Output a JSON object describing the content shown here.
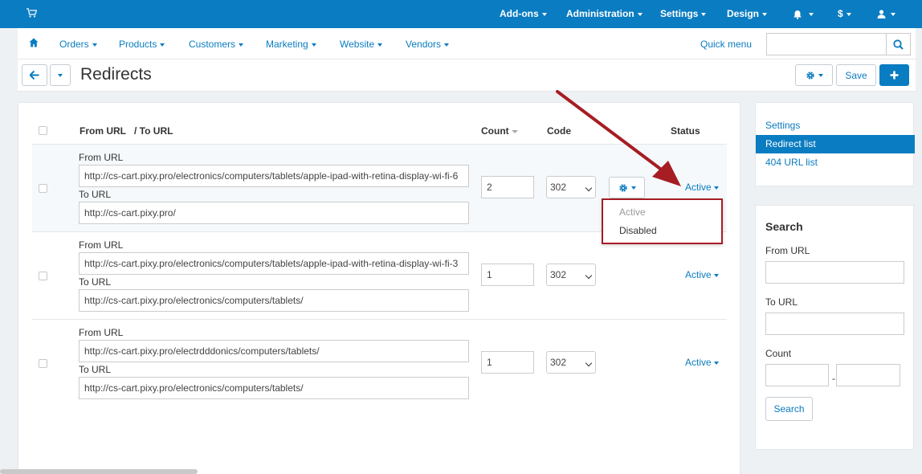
{
  "topbar": {
    "menu": [
      "Add-ons",
      "Administration",
      "Settings",
      "Design"
    ],
    "currency": "$"
  },
  "nav": {
    "items": [
      "Orders",
      "Products",
      "Customers",
      "Marketing",
      "Website",
      "Vendors"
    ],
    "quick_menu": "Quick menu"
  },
  "page": {
    "title": "Redirects",
    "save_label": "Save"
  },
  "table": {
    "headers": {
      "from_url": "From URL",
      "to_url": "/ To URL",
      "count": "Count",
      "code": "Code",
      "status": "Status"
    },
    "from_label": "From URL",
    "to_label": "To URL",
    "rows": [
      {
        "from": "http://cs-cart.pixy.pro/electronics/computers/tablets/apple-ipad-with-retina-display-wi-fi-6",
        "to": "http://cs-cart.pixy.pro/",
        "count": "2",
        "code": "302",
        "status": "Active"
      },
      {
        "from": "http://cs-cart.pixy.pro/electronics/computers/tablets/apple-ipad-with-retina-display-wi-fi-3",
        "to": "http://cs-cart.pixy.pro/electronics/computers/tablets/",
        "count": "1",
        "code": "302",
        "status": "Active"
      },
      {
        "from": "http://cs-cart.pixy.pro/electrdddonics/computers/tablets/",
        "to": "http://cs-cart.pixy.pro/electronics/computers/tablets/",
        "count": "1",
        "code": "302",
        "status": "Active"
      }
    ]
  },
  "status_dropdown": {
    "options": [
      "Active",
      "Disabled"
    ]
  },
  "sidebar": {
    "links": [
      "Settings",
      "Redirect list",
      "404 URL list"
    ],
    "search": {
      "title": "Search",
      "from_label": "From URL",
      "to_label": "To URL",
      "count_label": "Count",
      "range_sep": "-",
      "button": "Search"
    }
  },
  "colors": {
    "brand_blue": "#0a7cc1",
    "annotation_red": "#a61d24"
  }
}
